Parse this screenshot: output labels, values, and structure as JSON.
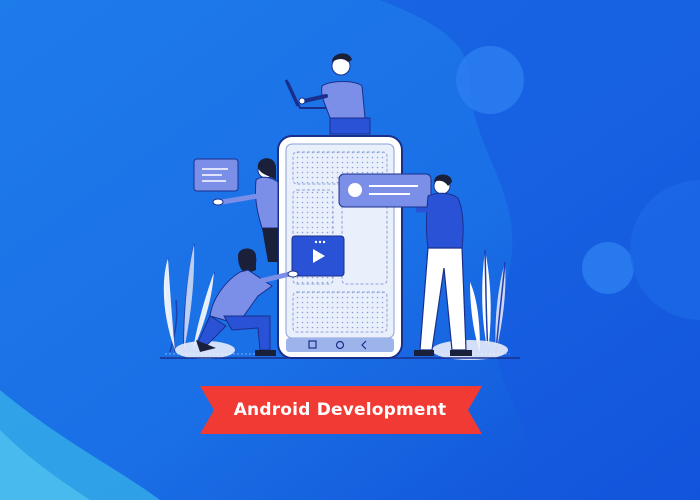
{
  "banner": {
    "label": "Android Development"
  },
  "colors": {
    "background": "#1565e8",
    "banner": "#f23a35",
    "figure_blue": "#2a52d6",
    "figure_light": "#7b8fe8"
  },
  "icons": [
    "laptop-icon",
    "play-icon",
    "message-card-icon",
    "nav-square-icon",
    "nav-circle-icon",
    "nav-back-icon"
  ]
}
